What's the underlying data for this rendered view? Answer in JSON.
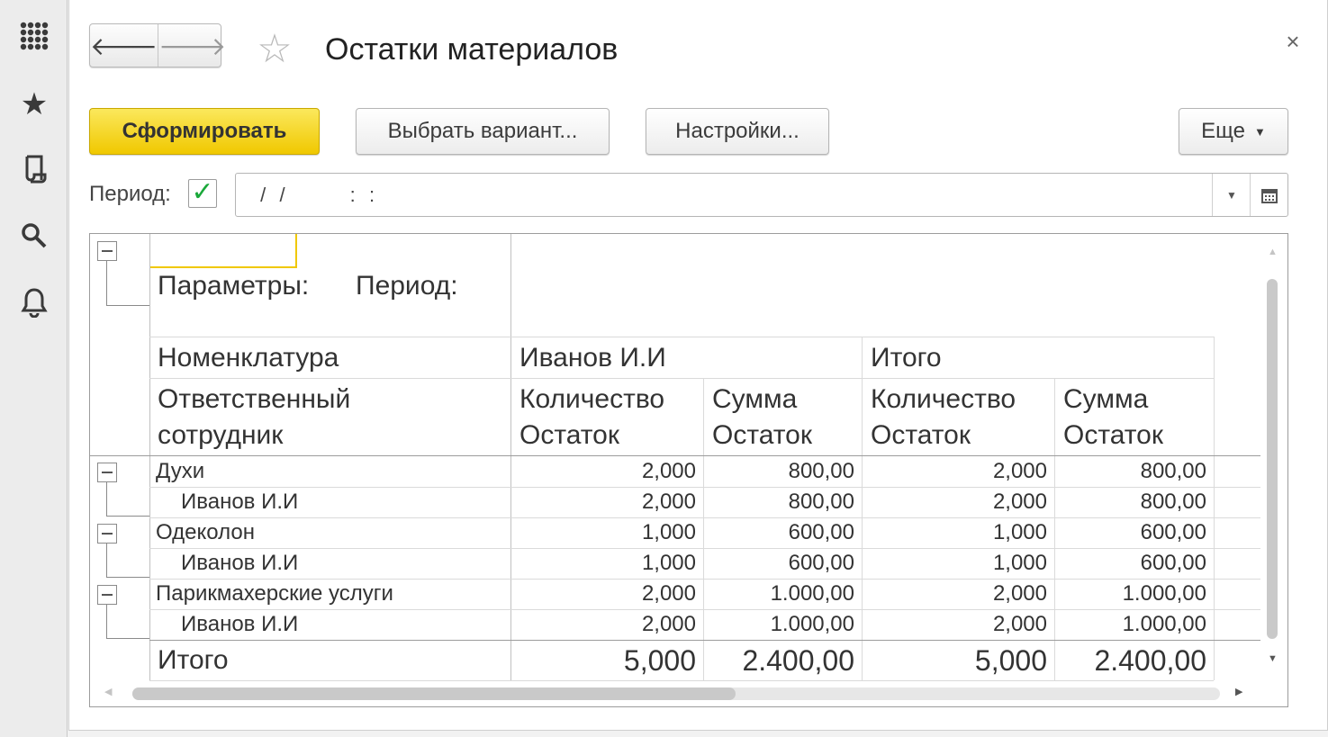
{
  "window": {
    "title": "Остатки материалов",
    "close_glyph": "×"
  },
  "toolbar": {
    "generate_label": "Сформировать",
    "choose_variant_label": "Выбрать вариант...",
    "settings_label": "Настройки...",
    "more_label": "Еще"
  },
  "period": {
    "label": "Период:",
    "checked": true,
    "value": " /  /          :  :"
  },
  "report": {
    "parameters_label": "Параметры:",
    "period_label": "Период:",
    "headers": {
      "nomenclature": "Номенклатура",
      "responsible_line1": "Ответственный",
      "responsible_line2": "сотрудник",
      "group1": "Иванов И.И",
      "group2": "Итого",
      "qty_line1": "Количество",
      "qty_line2": "Остаток",
      "sum_line1": "Сумма",
      "sum_line2": "Остаток"
    },
    "rows": [
      {
        "name": "Духи",
        "level": 0,
        "q1": "2,000",
        "s1": "800,00",
        "q2": "2,000",
        "s2": "800,00"
      },
      {
        "name": "Иванов И.И",
        "level": 1,
        "q1": "2,000",
        "s1": "800,00",
        "q2": "2,000",
        "s2": "800,00"
      },
      {
        "name": "Одеколон",
        "level": 0,
        "q1": "1,000",
        "s1": "600,00",
        "q2": "1,000",
        "s2": "600,00"
      },
      {
        "name": "Иванов И.И",
        "level": 1,
        "q1": "1,000",
        "s1": "600,00",
        "q2": "1,000",
        "s2": "600,00"
      },
      {
        "name": "Парикмахерские услуги",
        "level": 0,
        "q1": "2,000",
        "s1": "1.000,00",
        "q2": "2,000",
        "s2": "1.000,00"
      },
      {
        "name": "Иванов И.И",
        "level": 1,
        "q1": "2,000",
        "s1": "1.000,00",
        "q2": "2,000",
        "s2": "1.000,00"
      }
    ],
    "total": {
      "name": "Итого",
      "q1": "5,000",
      "s1": "2.400,00",
      "q2": "5,000",
      "s2": "2.400,00"
    }
  },
  "colors": {
    "accent": "#f0c800",
    "check": "#1aa83a"
  }
}
